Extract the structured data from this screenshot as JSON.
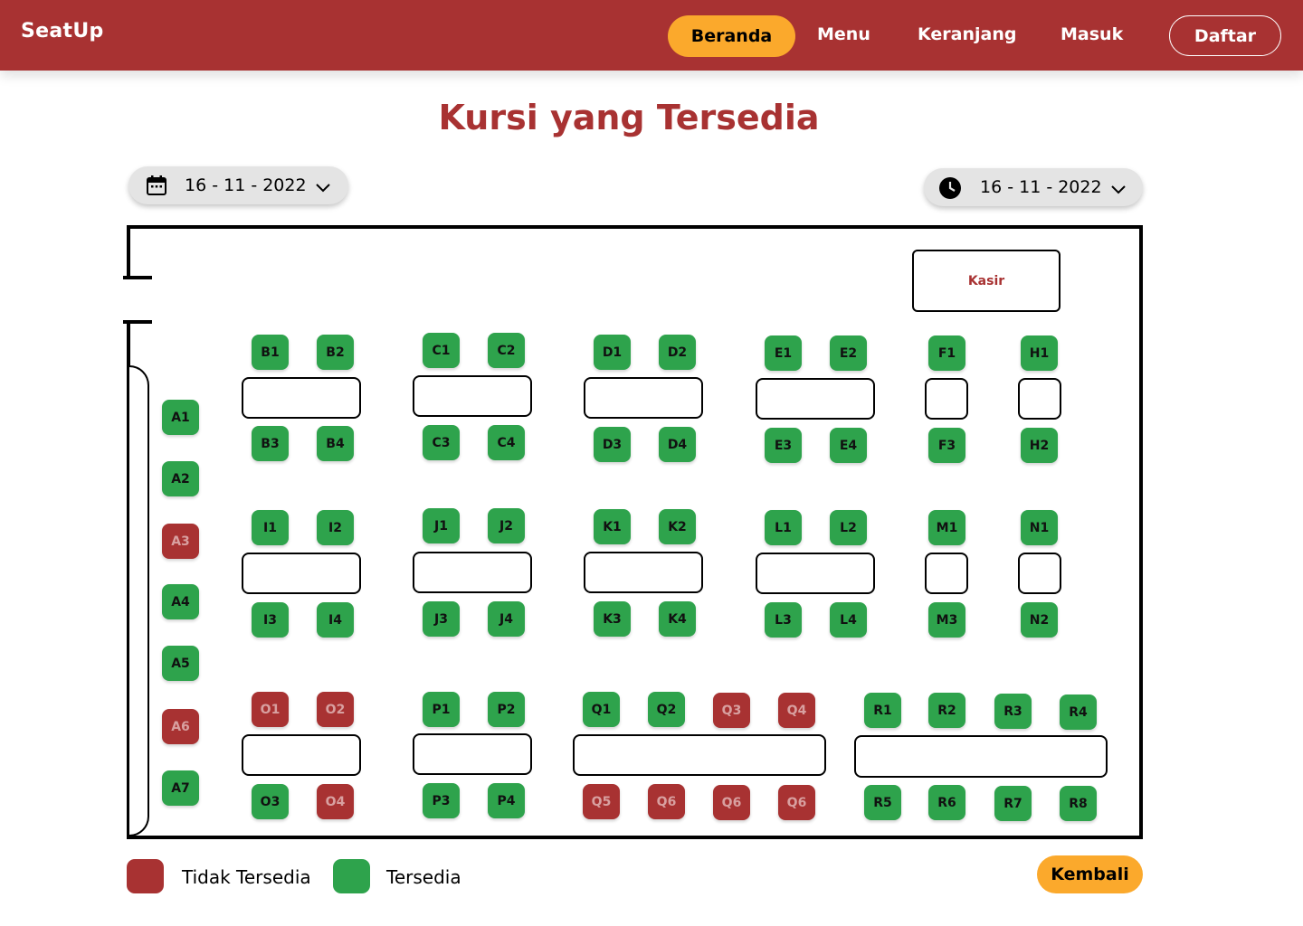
{
  "nav": {
    "brand": "SeatUp",
    "home": "Beranda",
    "menu": "Menu",
    "cart": "Keranjang",
    "login": "Masuk",
    "register": "Daftar"
  },
  "page": {
    "title": "Kursi yang Tersedia"
  },
  "filters": {
    "date": {
      "icon": "calendar-icon",
      "value": "16 - 11 - 2022"
    },
    "time": {
      "icon": "clock-icon",
      "value": "16 - 11 - 2022"
    }
  },
  "room": {
    "cashier_label": "Kasir"
  },
  "colors": {
    "brand": "#A83232",
    "accent": "#FBA92C",
    "available": "#2EA34C",
    "unavailable": "#A83232"
  },
  "seats": [
    {
      "id": "A1",
      "status": "available"
    },
    {
      "id": "A2",
      "status": "available"
    },
    {
      "id": "A3",
      "status": "unavailable"
    },
    {
      "id": "A4",
      "status": "available"
    },
    {
      "id": "A5",
      "status": "available"
    },
    {
      "id": "A6",
      "status": "unavailable"
    },
    {
      "id": "A7",
      "status": "available"
    },
    {
      "id": "B1",
      "status": "available"
    },
    {
      "id": "B2",
      "status": "available"
    },
    {
      "id": "B3",
      "status": "available"
    },
    {
      "id": "B4",
      "status": "available"
    },
    {
      "id": "C1",
      "status": "available"
    },
    {
      "id": "C2",
      "status": "available"
    },
    {
      "id": "C3",
      "status": "available"
    },
    {
      "id": "C4",
      "status": "available"
    },
    {
      "id": "D1",
      "status": "available"
    },
    {
      "id": "D2",
      "status": "available"
    },
    {
      "id": "D3",
      "status": "available"
    },
    {
      "id": "D4",
      "status": "available"
    },
    {
      "id": "E1",
      "status": "available"
    },
    {
      "id": "E2",
      "status": "available"
    },
    {
      "id": "E3",
      "status": "available"
    },
    {
      "id": "E4",
      "status": "available"
    },
    {
      "id": "F1",
      "status": "available"
    },
    {
      "id": "F3",
      "status": "available"
    },
    {
      "id": "H1",
      "status": "available"
    },
    {
      "id": "H2",
      "status": "available"
    },
    {
      "id": "I1",
      "status": "available"
    },
    {
      "id": "I2",
      "status": "available"
    },
    {
      "id": "I3",
      "status": "available"
    },
    {
      "id": "I4",
      "status": "available"
    },
    {
      "id": "J1",
      "status": "available"
    },
    {
      "id": "J2",
      "status": "available"
    },
    {
      "id": "J3",
      "status": "available"
    },
    {
      "id": "J4",
      "status": "available"
    },
    {
      "id": "K1",
      "status": "available"
    },
    {
      "id": "K2",
      "status": "available"
    },
    {
      "id": "K3",
      "status": "available"
    },
    {
      "id": "K4",
      "status": "available"
    },
    {
      "id": "L1",
      "status": "available"
    },
    {
      "id": "L2",
      "status": "available"
    },
    {
      "id": "L3",
      "status": "available"
    },
    {
      "id": "L4",
      "status": "available"
    },
    {
      "id": "M1",
      "status": "available"
    },
    {
      "id": "M3",
      "status": "available"
    },
    {
      "id": "N1",
      "status": "available"
    },
    {
      "id": "N2",
      "status": "available"
    },
    {
      "id": "O1",
      "status": "unavailable"
    },
    {
      "id": "O2",
      "status": "unavailable"
    },
    {
      "id": "O3",
      "status": "available"
    },
    {
      "id": "O4",
      "status": "unavailable"
    },
    {
      "id": "P1",
      "status": "available"
    },
    {
      "id": "P2",
      "status": "available"
    },
    {
      "id": "P3",
      "status": "available"
    },
    {
      "id": "P4",
      "status": "available"
    },
    {
      "id": "Q1",
      "status": "available"
    },
    {
      "id": "Q2",
      "status": "available"
    },
    {
      "id": "Q3",
      "status": "unavailable"
    },
    {
      "id": "Q4",
      "status": "unavailable"
    },
    {
      "id": "Q5",
      "status": "unavailable"
    },
    {
      "id": "Q6",
      "status": "unavailable"
    },
    {
      "id": "Q6",
      "status": "unavailable"
    },
    {
      "id": "Q6",
      "status": "unavailable"
    },
    {
      "id": "R1",
      "status": "available"
    },
    {
      "id": "R2",
      "status": "available"
    },
    {
      "id": "R3",
      "status": "available"
    },
    {
      "id": "R4",
      "status": "available"
    },
    {
      "id": "R5",
      "status": "available"
    },
    {
      "id": "R6",
      "status": "available"
    },
    {
      "id": "R7",
      "status": "available"
    },
    {
      "id": "R8",
      "status": "available"
    }
  ],
  "legend": {
    "unavailable": "Tidak Tersedia",
    "available": "Tersedia"
  },
  "actions": {
    "back": "Kembali"
  }
}
